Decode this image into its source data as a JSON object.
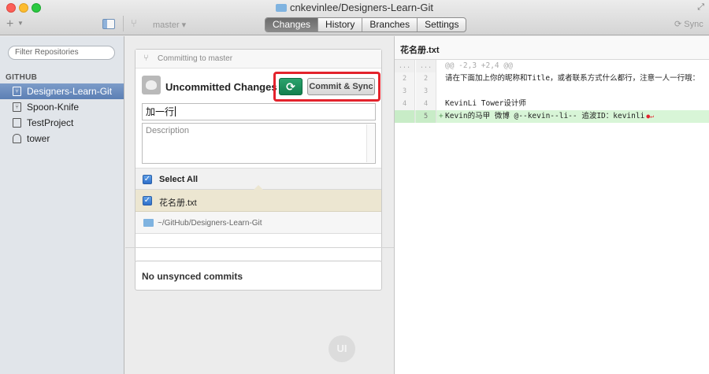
{
  "window": {
    "title": "cnkevinlee/Designers-Learn-Git"
  },
  "toolbar": {
    "add_label": "+",
    "branch": "master",
    "tabs": [
      {
        "label": "Changes",
        "active": true
      },
      {
        "label": "History",
        "active": false
      },
      {
        "label": "Branches",
        "active": false
      },
      {
        "label": "Settings",
        "active": false
      }
    ],
    "sync_label": "Sync"
  },
  "sidebar": {
    "filter_placeholder": "Filter Repositories",
    "section": "GITHUB",
    "repos": [
      {
        "name": "Designers-Learn-Git",
        "selected": true
      },
      {
        "name": "Spoon-Knife",
        "selected": false
      },
      {
        "name": "TestProject",
        "selected": false
      },
      {
        "name": "tower",
        "selected": false
      }
    ]
  },
  "commit": {
    "header": "Committing to master",
    "title": "Uncommitted Changes",
    "commit_sync_label": "Commit & Sync",
    "summary_value": "加一行",
    "description_placeholder": "Description",
    "select_all_label": "Select All",
    "file_name": "花名册.txt",
    "repo_path": "~/GitHub/Designers-Learn-Git"
  },
  "unsynced": {
    "label": "No unsynced commits"
  },
  "diff": {
    "filename": "花名册.txt",
    "lines": [
      {
        "a": "...",
        "b": "...",
        "text": "@@ -2,3 +2,4 @@",
        "type": "hunk"
      },
      {
        "a": "2",
        "b": "2",
        "text": "请在下面加上你的昵称和Title，或者联系方式什么都行，注意一人一行哦：",
        "type": "context"
      },
      {
        "a": "3",
        "b": "3",
        "text": "",
        "type": "context"
      },
      {
        "a": "4",
        "b": "4",
        "text": "KevinLi     Tower设计师",
        "type": "context"
      },
      {
        "a": "",
        "b": "5",
        "text": "Kevin的马甲   微博 @--kevin--li--  追波ID：kevinli",
        "type": "added"
      }
    ]
  },
  "colors": {
    "accent_green": "#1f9460",
    "highlight_red": "#e3232c",
    "selected_repo": "#6a8dc0",
    "added_line": "#d8f5d7"
  }
}
